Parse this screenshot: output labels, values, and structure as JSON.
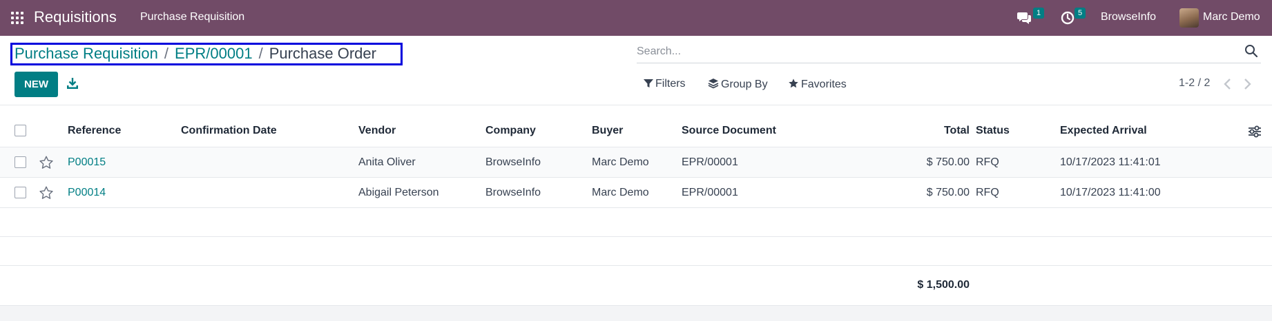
{
  "navbar": {
    "app_name": "Requisitions",
    "menu_item": "Purchase Requisition",
    "messages_count": "1",
    "activities_count": "5",
    "company": "BrowseInfo",
    "user": "Marc Demo"
  },
  "breadcrumb": {
    "items": [
      "Purchase Requisition",
      "EPR/00001"
    ],
    "separator": "/",
    "current": "Purchase Order"
  },
  "search": {
    "placeholder": "Search..."
  },
  "toolbar": {
    "new_label": "NEW"
  },
  "filters": {
    "filters_label": "Filters",
    "group_by_label": "Group By",
    "favorites_label": "Favorites"
  },
  "pager": {
    "value": "1-2 / 2"
  },
  "table": {
    "columns": [
      "Reference",
      "Confirmation Date",
      "Vendor",
      "Company",
      "Buyer",
      "Source Document",
      "Total",
      "Status",
      "Expected Arrival"
    ],
    "rows": [
      {
        "reference": "P00015",
        "confirmation_date": "",
        "vendor": "Anita Oliver",
        "company": "BrowseInfo",
        "buyer": "Marc Demo",
        "source_document": "EPR/00001",
        "total": "$ 750.00",
        "status": "RFQ",
        "expected_arrival": "10/17/2023 11:41:01"
      },
      {
        "reference": "P00014",
        "confirmation_date": "",
        "vendor": "Abigail Peterson",
        "company": "BrowseInfo",
        "buyer": "Marc Demo",
        "source_document": "EPR/00001",
        "total": "$ 750.00",
        "status": "RFQ",
        "expected_arrival": "10/17/2023 11:41:00"
      }
    ],
    "total_sum": "$ 1,500.00"
  },
  "colors": {
    "navbar": "#714b67",
    "accent": "#017e84",
    "highlight_box": "#0000dd"
  }
}
